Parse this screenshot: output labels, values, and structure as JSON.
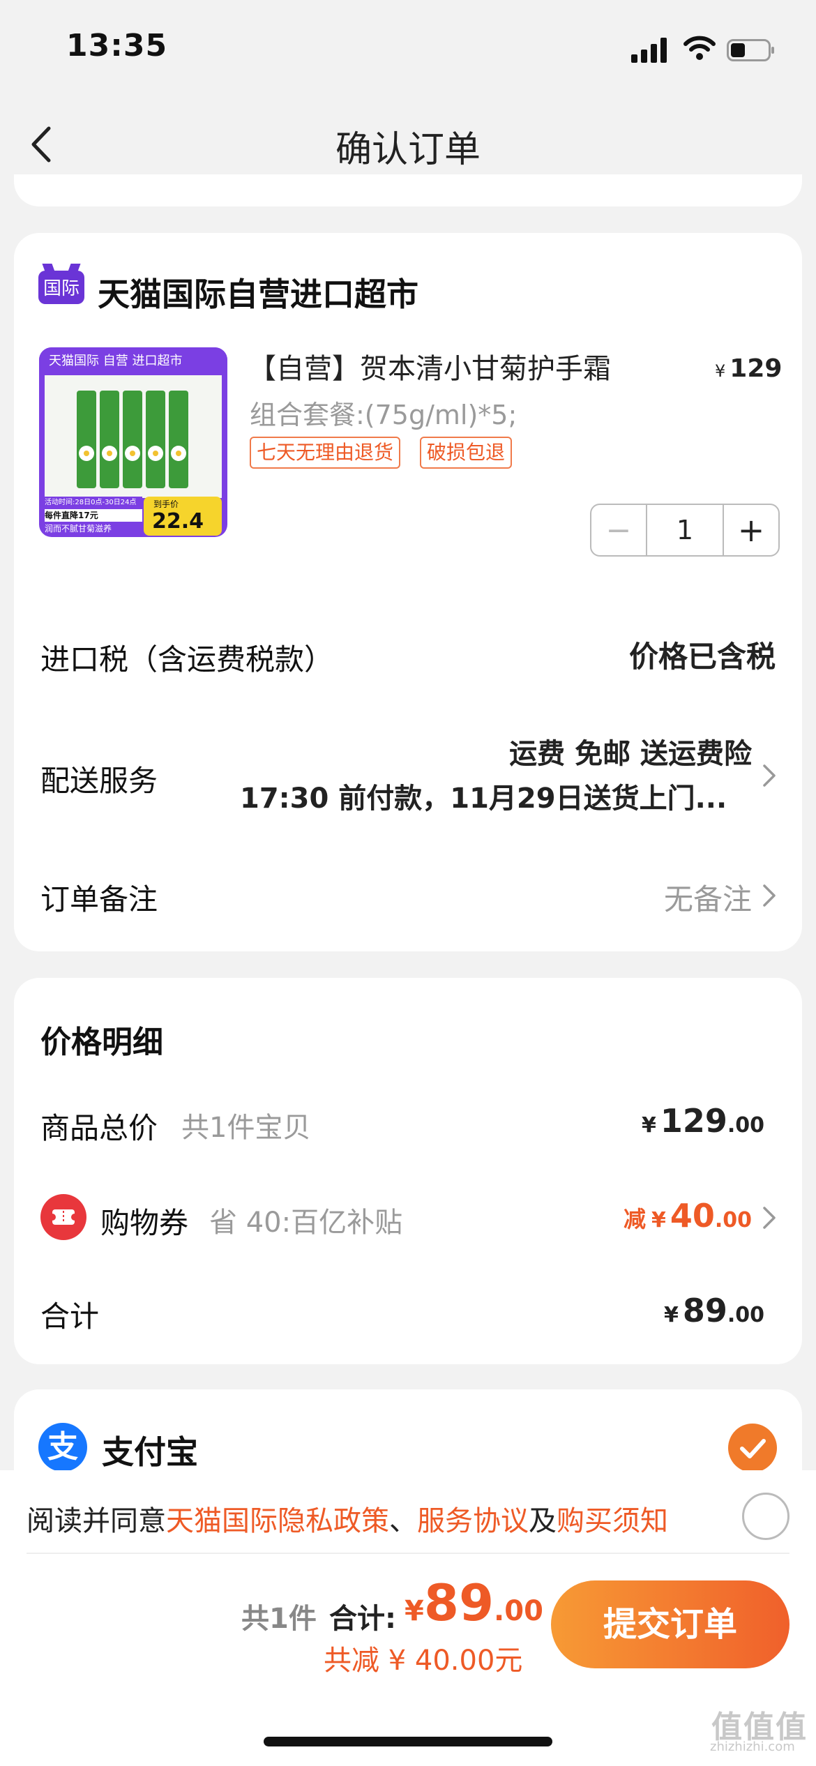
{
  "status_bar": {
    "time": "13:35"
  },
  "nav": {
    "title": "确认订单"
  },
  "store": {
    "badge": "国际",
    "name": "天猫国际自营进口超市"
  },
  "product": {
    "name": "【自营】贺本清小甘菊护手霜",
    "currency": "¥",
    "price": "129",
    "spec": "组合套餐:(75g/ml)*5;",
    "tags": [
      "七天无理由退货",
      "破损包退"
    ],
    "quantity": "1",
    "image_text": {
      "header": "天猫国际 自营 进口超市",
      "promo_time": "活动时间:28日0点-30日24点",
      "promo_line1": "每件直降17元",
      "promo_line2": "润而不腻甘菊滋养",
      "price_badge": "到手价",
      "price_value": "22.4"
    }
  },
  "rows": {
    "tax_label": "进口税（含运费税款）",
    "tax_value": "价格已含税",
    "delivery_label": "配送服务",
    "delivery_line1": "运费 免邮 送运费险",
    "delivery_line2": "17:30 前付款，11月29日送货上门...",
    "note_label": "订单备注",
    "note_value": "无备注"
  },
  "price_detail": {
    "title": "价格明细",
    "goods_label": "商品总价",
    "goods_count": "共1件宝贝",
    "goods_yen": "¥",
    "goods_int": "129",
    "goods_cents": ".00",
    "coupon_label": "购物券",
    "coupon_desc": "省 40:百亿补贴",
    "coupon_prefix": "减",
    "coupon_yen": "¥",
    "coupon_int": "40",
    "coupon_cents": ".00",
    "total_label": "合计",
    "total_yen": "¥",
    "total_int": "89",
    "total_cents": ".00"
  },
  "payment": {
    "name": "支付宝",
    "icon_char": "支"
  },
  "agreement": {
    "prefix": "阅读并同意",
    "link1": "天猫国际隐私政策",
    "sep1": "、",
    "link2": "服务协议",
    "sep2": "及",
    "link3": "购买须知"
  },
  "footer": {
    "count": "共1件",
    "total_label": "合计:",
    "yen": "¥",
    "amount_int": "89",
    "amount_cents": ".00",
    "saved": "共减 ¥ 40.00元",
    "submit": "提交订单"
  },
  "watermark": {
    "main": "值值值",
    "sub": "zhizhizhi.com"
  },
  "colors": {
    "accent": "#ee5a26",
    "store_purple": "#6a34d6",
    "alipay_blue": "#1677ff"
  }
}
